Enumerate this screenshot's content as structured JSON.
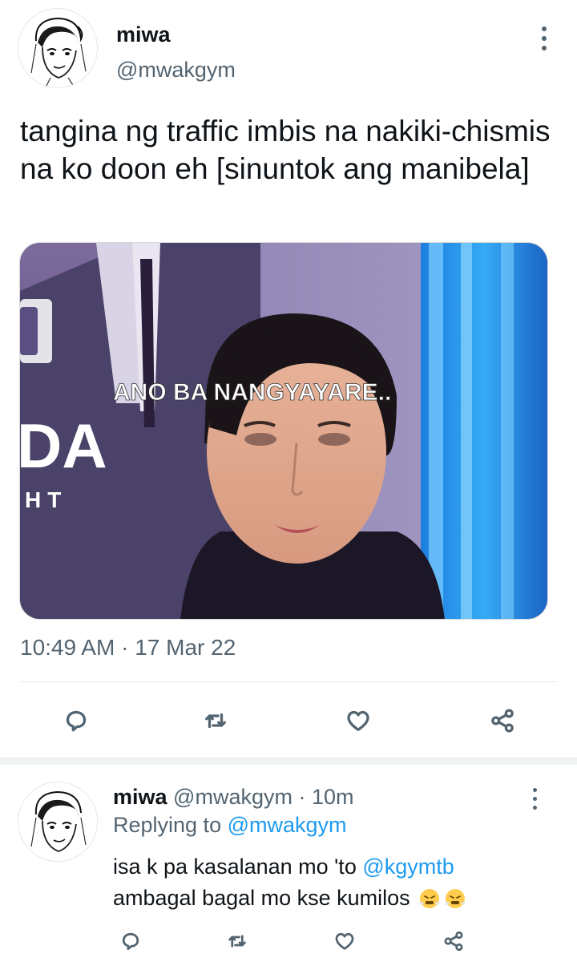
{
  "tweet": {
    "display_name": "miwa",
    "handle": "@mwakgym",
    "text": "tangina ng traffic imbis na nakiki-chismis na ko doon eh [sinuntok ang manibela]",
    "media": {
      "caption": "ANO BA NANGYAYARE..",
      "bg_letters_1": "DA",
      "bg_letters_2": "HT"
    },
    "time": "10:49 AM",
    "separator": "·",
    "date": "17 Mar 22",
    "actions": [
      "reply-icon",
      "retweet-icon",
      "like-icon",
      "share-icon"
    ]
  },
  "reply": {
    "display_name": "miwa",
    "handle": "@mwakgym",
    "separator": "·",
    "age": "10m",
    "replying_label": "Replying to",
    "replying_handle": "@mwakgym",
    "text_prefix": "isa k pa kasalanan mo 'to",
    "mention": "@kgymtb",
    "text_suffix": "ambagal bagal mo kse kumilos",
    "emojis": [
      "face-with-steam-icon",
      "face-with-steam-icon"
    ],
    "actions": [
      "reply-icon",
      "retweet-icon",
      "like-icon",
      "share-icon"
    ]
  },
  "colors": {
    "text": "#0f1419",
    "secondary": "#536471",
    "link": "#1d9bf0",
    "divider": "#eff3f4"
  }
}
